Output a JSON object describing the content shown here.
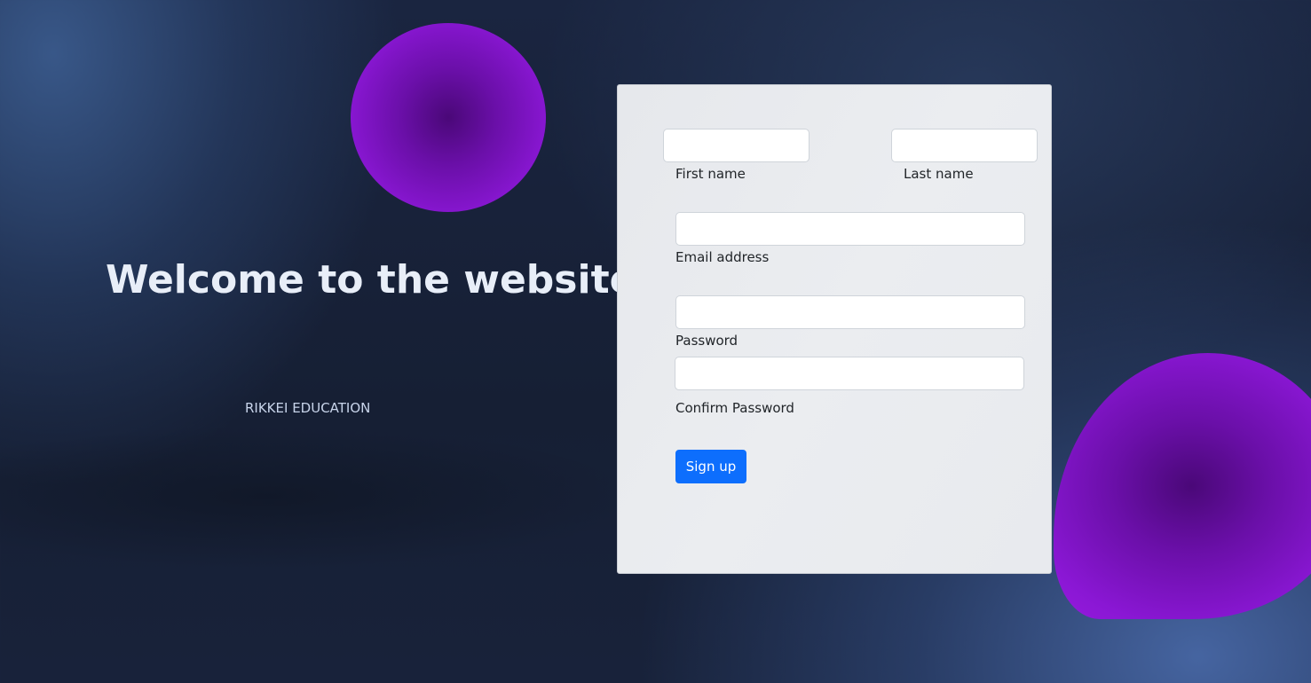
{
  "hero": {
    "title": "Welcome to the website",
    "subtitle": "RIKKEI EDUCATION"
  },
  "form": {
    "fields": {
      "first_name": {
        "label": "First name",
        "value": ""
      },
      "last_name": {
        "label": "Last name",
        "value": ""
      },
      "email": {
        "label": "Email address",
        "value": ""
      },
      "password": {
        "label": "Password",
        "value": ""
      },
      "confirm_password": {
        "label": "Confirm Password",
        "value": ""
      }
    },
    "submit_label": "Sign up"
  },
  "colors": {
    "accent": "#0d6efd",
    "blob": "#8a17d4",
    "background": "#1a2540"
  }
}
